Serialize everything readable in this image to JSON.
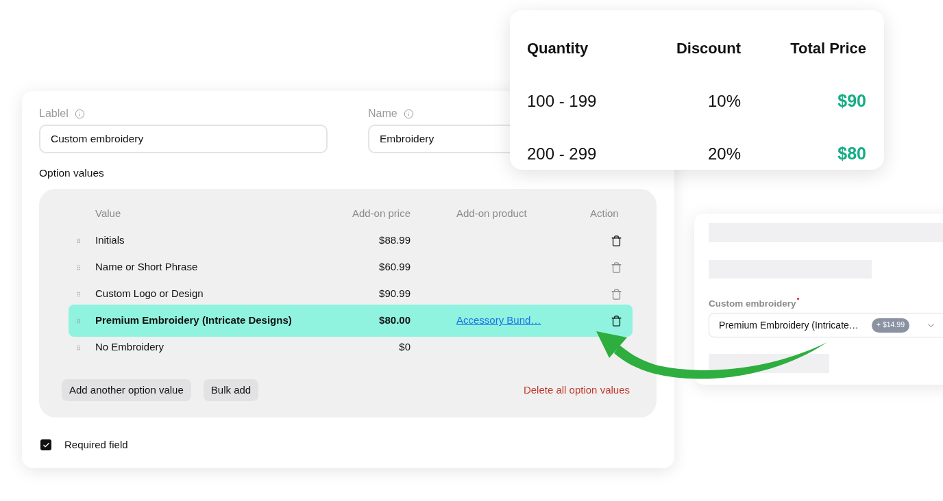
{
  "form": {
    "fields": [
      {
        "label": "Lablel",
        "value": "Custom embroidery"
      },
      {
        "label": "Name",
        "value": "Embroidery"
      }
    ],
    "option_values": {
      "title": "Option values",
      "columns": [
        "Value",
        "Add-on price",
        "Add-on product",
        "Action"
      ],
      "rows": [
        {
          "value": "Initials",
          "price": "$88.99",
          "selected": false,
          "show_delete": true,
          "delete_active": true
        },
        {
          "value": "Name or Short Phrase",
          "price": "$60.99",
          "selected": false,
          "show_delete": true,
          "delete_active": false
        },
        {
          "value": "Custom Logo or Design",
          "price": "$90.99",
          "selected": false,
          "show_delete": true,
          "delete_active": false
        },
        {
          "value": "Premium Embroidery (Intricate Designs)",
          "price": "$80.00",
          "product": "Accessory Bund…",
          "selected": true,
          "show_delete": true,
          "delete_active": true
        },
        {
          "value": "No Embroidery",
          "price": "$0",
          "selected": false,
          "show_delete": false
        }
      ],
      "buttons": [
        "Add another option value",
        "Bulk add"
      ],
      "delete_all": "Delete all option values"
    },
    "required_field": {
      "label": "Required field",
      "checked": true
    }
  },
  "pricing_table": {
    "columns": [
      "Quantity",
      "Discount",
      "Total Price"
    ],
    "rows": [
      [
        "100 - 199",
        "10%",
        "$90"
      ],
      [
        "200 - 299",
        "20%",
        "$80"
      ]
    ]
  },
  "preview": {
    "label": "Custom embroidery",
    "required": true,
    "select": {
      "value": "Premium Embroidery (Intricate…",
      "badge": "+ $14.99"
    }
  }
}
